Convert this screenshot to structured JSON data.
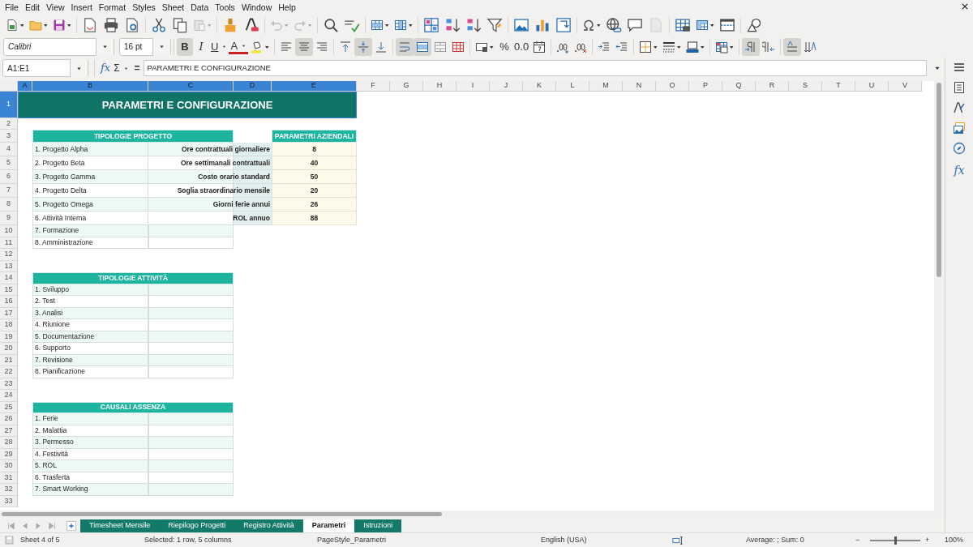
{
  "menu": [
    "File",
    "Edit",
    "View",
    "Insert",
    "Format",
    "Styles",
    "Sheet",
    "Data",
    "Tools",
    "Window",
    "Help"
  ],
  "standard_toolbar": [
    {
      "kind": "new",
      "disabled": false,
      "dropdown": true
    },
    {
      "kind": "open",
      "disabled": false,
      "dropdown": true
    },
    {
      "kind": "save",
      "disabled": false,
      "dropdown": true
    },
    {
      "kind": "pdf",
      "disabled": false,
      "dropdown": false
    },
    {
      "kind": "print",
      "disabled": false,
      "dropdown": false
    },
    {
      "kind": "preview",
      "disabled": false,
      "dropdown": false
    },
    {
      "kind": "cut",
      "disabled": false,
      "dropdown": false
    },
    {
      "kind": "copy",
      "disabled": false,
      "dropdown": false
    },
    {
      "kind": "paste",
      "disabled": true,
      "dropdown": true
    },
    {
      "kind": "clone",
      "disabled": false,
      "dropdown": false
    },
    {
      "kind": "clear",
      "disabled": false,
      "dropdown": false
    },
    {
      "kind": "undo",
      "disabled": true,
      "dropdown": true
    },
    {
      "kind": "redo",
      "disabled": true,
      "dropdown": true
    },
    {
      "kind": "find",
      "disabled": false,
      "dropdown": false
    },
    {
      "kind": "spell",
      "disabled": false,
      "dropdown": false
    },
    {
      "kind": "row",
      "disabled": false,
      "dropdown": true
    },
    {
      "kind": "column",
      "disabled": false,
      "dropdown": true
    },
    {
      "kind": "sort",
      "disabled": false,
      "dropdown": false
    },
    {
      "kind": "sortasc",
      "disabled": false,
      "dropdown": false
    },
    {
      "kind": "sortdesc",
      "disabled": false,
      "dropdown": false
    },
    {
      "kind": "filter",
      "disabled": false,
      "dropdown": false
    },
    {
      "kind": "image",
      "disabled": false,
      "dropdown": false
    },
    {
      "kind": "chart",
      "disabled": false,
      "dropdown": false
    },
    {
      "kind": "pivot",
      "disabled": false,
      "dropdown": false
    },
    {
      "kind": "special",
      "disabled": false,
      "dropdown": true
    },
    {
      "kind": "link",
      "disabled": false,
      "dropdown": false
    },
    {
      "kind": "comment",
      "disabled": false,
      "dropdown": false
    },
    {
      "kind": "headerfooter",
      "disabled": true,
      "dropdown": false
    },
    {
      "kind": "printarea",
      "disabled": false,
      "dropdown": false
    },
    {
      "kind": "freeze",
      "disabled": false,
      "dropdown": true
    },
    {
      "kind": "split",
      "disabled": false,
      "dropdown": false
    },
    {
      "kind": "shapes",
      "disabled": false,
      "dropdown": false
    }
  ],
  "formatting_toolbar": {
    "font_name": "Calibri",
    "font_size": "16 pt",
    "buttons": [
      {
        "kind": "bold",
        "label": "B",
        "selected": true,
        "dropdown": false
      },
      {
        "kind": "italic",
        "label": "I",
        "selected": false,
        "dropdown": false
      },
      {
        "kind": "underline",
        "label": "U",
        "selected": false,
        "dropdown": true
      },
      {
        "kind": "fontcolor",
        "label": "A",
        "selected": false,
        "dropdown": true
      },
      {
        "kind": "highlight",
        "selected": false,
        "dropdown": true
      },
      {
        "kind": "align_left",
        "selected": false,
        "dropdown": false
      },
      {
        "kind": "align_center",
        "selected": true,
        "dropdown": false
      },
      {
        "kind": "align_right",
        "selected": false,
        "dropdown": false
      },
      {
        "kind": "valign_top",
        "selected": false,
        "dropdown": false
      },
      {
        "kind": "valign_center",
        "selected": true,
        "dropdown": false
      },
      {
        "kind": "valign_bottom",
        "selected": false,
        "dropdown": false
      },
      {
        "kind": "wrap",
        "selected": true,
        "dropdown": false
      },
      {
        "kind": "merge_center",
        "selected": true,
        "dropdown": false
      },
      {
        "kind": "merge",
        "selected": false,
        "dropdown": false
      },
      {
        "kind": "unmerge",
        "selected": false,
        "dropdown": false
      },
      {
        "kind": "currency",
        "selected": false,
        "dropdown": true
      },
      {
        "kind": "percent",
        "label": "%",
        "selected": false,
        "dropdown": false
      },
      {
        "kind": "number",
        "label": "0.0",
        "selected": false,
        "dropdown": false
      },
      {
        "kind": "date",
        "selected": false,
        "dropdown": false
      },
      {
        "kind": "add_decimal",
        "selected": false,
        "dropdown": false
      },
      {
        "kind": "delete_decimal",
        "selected": false,
        "dropdown": false
      },
      {
        "kind": "indent_increase",
        "selected": false,
        "dropdown": false
      },
      {
        "kind": "indent_decrease",
        "selected": false,
        "dropdown": false
      },
      {
        "kind": "borders",
        "selected": false,
        "dropdown": true
      },
      {
        "kind": "border_style",
        "selected": false,
        "dropdown": true
      },
      {
        "kind": "border_color",
        "selected": false,
        "dropdown": true
      },
      {
        "kind": "conditional",
        "selected": false,
        "dropdown": true
      },
      {
        "kind": "ltr",
        "selected": true,
        "dropdown": false
      },
      {
        "kind": "rtl",
        "selected": false,
        "dropdown": false
      },
      {
        "kind": "text_direction",
        "selected": true,
        "dropdown": false
      },
      {
        "kind": "vertical_text",
        "selected": false,
        "dropdown": false
      }
    ]
  },
  "formula_bar": {
    "name_box": "A1:E1",
    "function_wizard": "fx",
    "sum": "Σ",
    "equals": "=",
    "content": "PARAMETRI E CONFIGURAZIONE"
  },
  "sheet": {
    "columns": [
      {
        "label": "A",
        "selected": true
      },
      {
        "label": "B",
        "selected": true
      },
      {
        "label": "C",
        "selected": true
      },
      {
        "label": "D",
        "selected": true
      },
      {
        "label": "E",
        "selected": true
      },
      {
        "label": "F",
        "selected": false
      },
      {
        "label": "G",
        "selected": false
      },
      {
        "label": "H",
        "selected": false
      },
      {
        "label": "I",
        "selected": false
      },
      {
        "label": "J",
        "selected": false
      },
      {
        "label": "K",
        "selected": false
      },
      {
        "label": "L",
        "selected": false
      },
      {
        "label": "M",
        "selected": false
      },
      {
        "label": "N",
        "selected": false
      },
      {
        "label": "O",
        "selected": false
      },
      {
        "label": "P",
        "selected": false
      },
      {
        "label": "Q",
        "selected": false
      },
      {
        "label": "R",
        "selected": false
      },
      {
        "label": "S",
        "selected": false
      },
      {
        "label": "T",
        "selected": false
      },
      {
        "label": "U",
        "selected": false
      },
      {
        "label": "V",
        "selected": false
      }
    ],
    "rows": [
      {
        "label": "1",
        "selected": true
      },
      {
        "label": "2",
        "selected": false
      },
      {
        "label": "3",
        "selected": false
      },
      {
        "label": "4",
        "selected": false
      },
      {
        "label": "5",
        "selected": false
      },
      {
        "label": "6",
        "selected": false
      },
      {
        "label": "7",
        "selected": false
      },
      {
        "label": "8",
        "selected": false
      },
      {
        "label": "9",
        "selected": false
      },
      {
        "label": "10",
        "selected": false
      },
      {
        "label": "11",
        "selected": false
      },
      {
        "label": "12",
        "selected": false
      },
      {
        "label": "13",
        "selected": false
      },
      {
        "label": "14",
        "selected": false
      },
      {
        "label": "15",
        "selected": false
      },
      {
        "label": "16",
        "selected": false
      },
      {
        "label": "17",
        "selected": false
      },
      {
        "label": "18",
        "selected": false
      },
      {
        "label": "19",
        "selected": false
      },
      {
        "label": "20",
        "selected": false
      },
      {
        "label": "21",
        "selected": false
      },
      {
        "label": "22",
        "selected": false
      },
      {
        "label": "23",
        "selected": false
      },
      {
        "label": "24",
        "selected": false
      },
      {
        "label": "25",
        "selected": false
      },
      {
        "label": "26",
        "selected": false
      },
      {
        "label": "27",
        "selected": false
      },
      {
        "label": "28",
        "selected": false
      },
      {
        "label": "29",
        "selected": false
      },
      {
        "label": "30",
        "selected": false
      },
      {
        "label": "31",
        "selected": false
      },
      {
        "label": "32",
        "selected": false
      },
      {
        "label": "33",
        "selected": false
      }
    ],
    "title": "PARAMETRI E CONFIGURAZIONE",
    "lists": [
      {
        "header": "TIPOLOGIE PROGETTO",
        "items": [
          "1. Progetto Alpha",
          "2. Progetto Beta",
          "3. Progetto Gamma",
          "4. Progetto Delta",
          "5. Progetto Omega",
          "6. Attività Interna",
          "7. Formazione",
          "8. Amministrazione"
        ]
      },
      {
        "header": "TIPOLOGIE ATTIVITÀ",
        "items": [
          "1. Sviluppo",
          "2. Test",
          "3. Analisi",
          "4. Riunione",
          "5. Documentazione",
          "6. Supporto",
          "7. Revisione",
          "8. Pianificazione"
        ]
      },
      {
        "header": "CAUSALI ASSENZA",
        "items": [
          "1. Ferie",
          "2. Malattia",
          "3. Permesso",
          "4. Festività",
          "5. ROL",
          "6. Trasferta",
          "7. Smart Working"
        ]
      }
    ],
    "parameters": {
      "header": "PARAMETRI AZIENDALI",
      "rows": [
        {
          "label": "Ore contrattuali giornaliere",
          "value": "8"
        },
        {
          "label": "Ore settimanali contrattuali",
          "value": "40"
        },
        {
          "label": "Costo orario standard",
          "value": "50"
        },
        {
          "label": "Soglia straordinario mensile",
          "value": "20"
        },
        {
          "label": "Giorni ferie annui",
          "value": "26"
        },
        {
          "label": "ROL annuo",
          "value": "88"
        }
      ]
    }
  },
  "sheet_tabs": [
    {
      "label": "Timesheet Mensile",
      "selected": false
    },
    {
      "label": "Riepilogo Progetti",
      "selected": false
    },
    {
      "label": "Registro Attività",
      "selected": false
    },
    {
      "label": "Parametri",
      "selected": true
    },
    {
      "label": "Istruzioni",
      "selected": false
    }
  ],
  "status_bar": {
    "sheet": "Sheet 4 of 5",
    "selection": "Selected: 1 row, 5 columns",
    "page_style": "PageStyle_Parametri",
    "language": "English (USA)",
    "summary": "Average: ; Sum: 0",
    "zoom_out": "−",
    "zoom_in": "+",
    "zoom": {
      "level": 0.48
    },
    "zoom_percent": "100%"
  },
  "sidebar": [
    {
      "kind": "menu"
    },
    {
      "kind": "properties"
    },
    {
      "kind": "styles"
    },
    {
      "kind": "gallery"
    },
    {
      "kind": "navigator"
    },
    {
      "kind": "functions",
      "label": "fx"
    }
  ]
}
